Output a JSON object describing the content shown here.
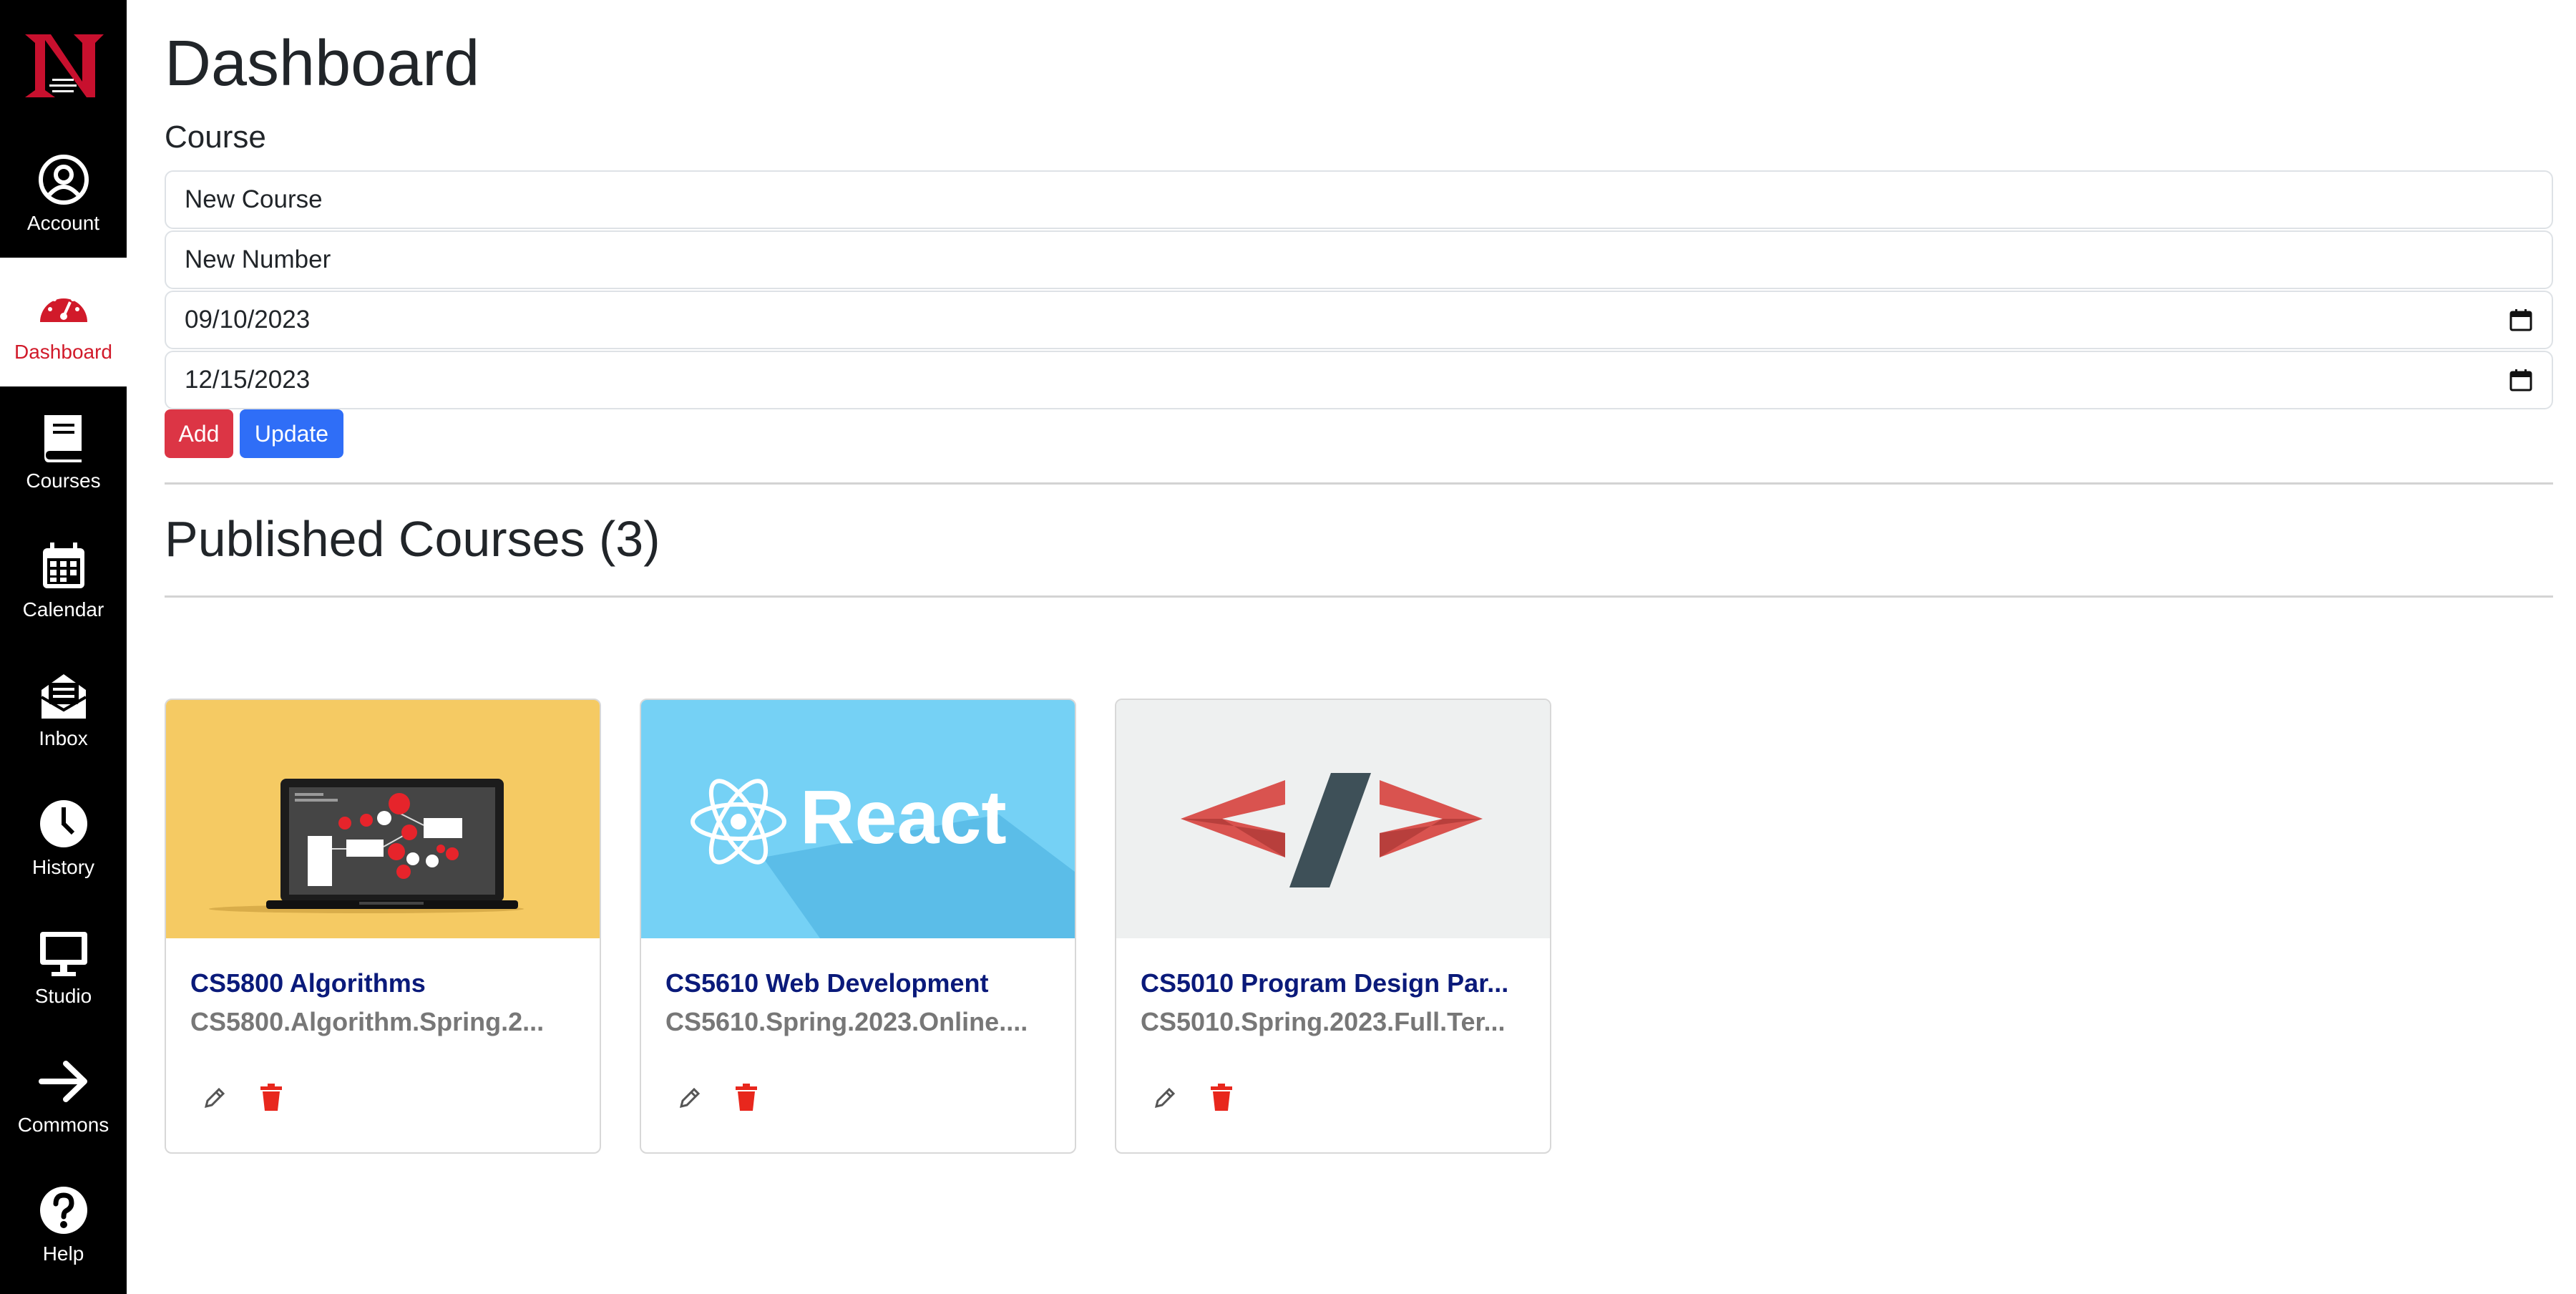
{
  "sidebar": {
    "logo_icon": "northeastern-n-logo",
    "items": [
      {
        "label": "Account",
        "icon": "account-icon"
      },
      {
        "label": "Dashboard",
        "icon": "dashboard-icon"
      },
      {
        "label": "Courses",
        "icon": "book-icon"
      },
      {
        "label": "Calendar",
        "icon": "calendar-icon"
      },
      {
        "label": "Inbox",
        "icon": "inbox-icon"
      },
      {
        "label": "History",
        "icon": "clock-icon"
      },
      {
        "label": "Studio",
        "icon": "monitor-icon"
      },
      {
        "label": "Commons",
        "icon": "arrow-right-icon"
      },
      {
        "label": "Help",
        "icon": "question-icon"
      }
    ],
    "active": "Dashboard"
  },
  "page": {
    "title": "Dashboard",
    "form_label": "Course"
  },
  "form": {
    "course_name": "New Course",
    "course_number": "New Number",
    "start_date": "09/10/2023",
    "end_date": "12/15/2023",
    "add_label": "Add",
    "update_label": "Update"
  },
  "published": {
    "title": "Published Courses (3)"
  },
  "courses": [
    {
      "title": "CS5800 Algorithms",
      "subtitle": "CS5800.Algorithm.Spring.2...",
      "image": "laptop-flowchart-image"
    },
    {
      "title": "CS5610 Web Development",
      "subtitle": "CS5610.Spring.2023.Online....",
      "image": "react-logo-image",
      "image_text": "React"
    },
    {
      "title": "CS5010 Program Design Par...",
      "subtitle": "CS5010.Spring.2023.Full.Ter...",
      "image": "code-brackets-image"
    }
  ],
  "colors": {
    "sidebar_bg": "#000000",
    "active_red": "#d11a2a",
    "add_button": "#dc3545",
    "update_button": "#2f6ef7",
    "card_title": "#0a1a7a",
    "delete_icon": "#e8271d",
    "card1_bg": "#f5ca63",
    "card2_bg": "#75d1f5",
    "card3_bg": "#eef0f0"
  }
}
